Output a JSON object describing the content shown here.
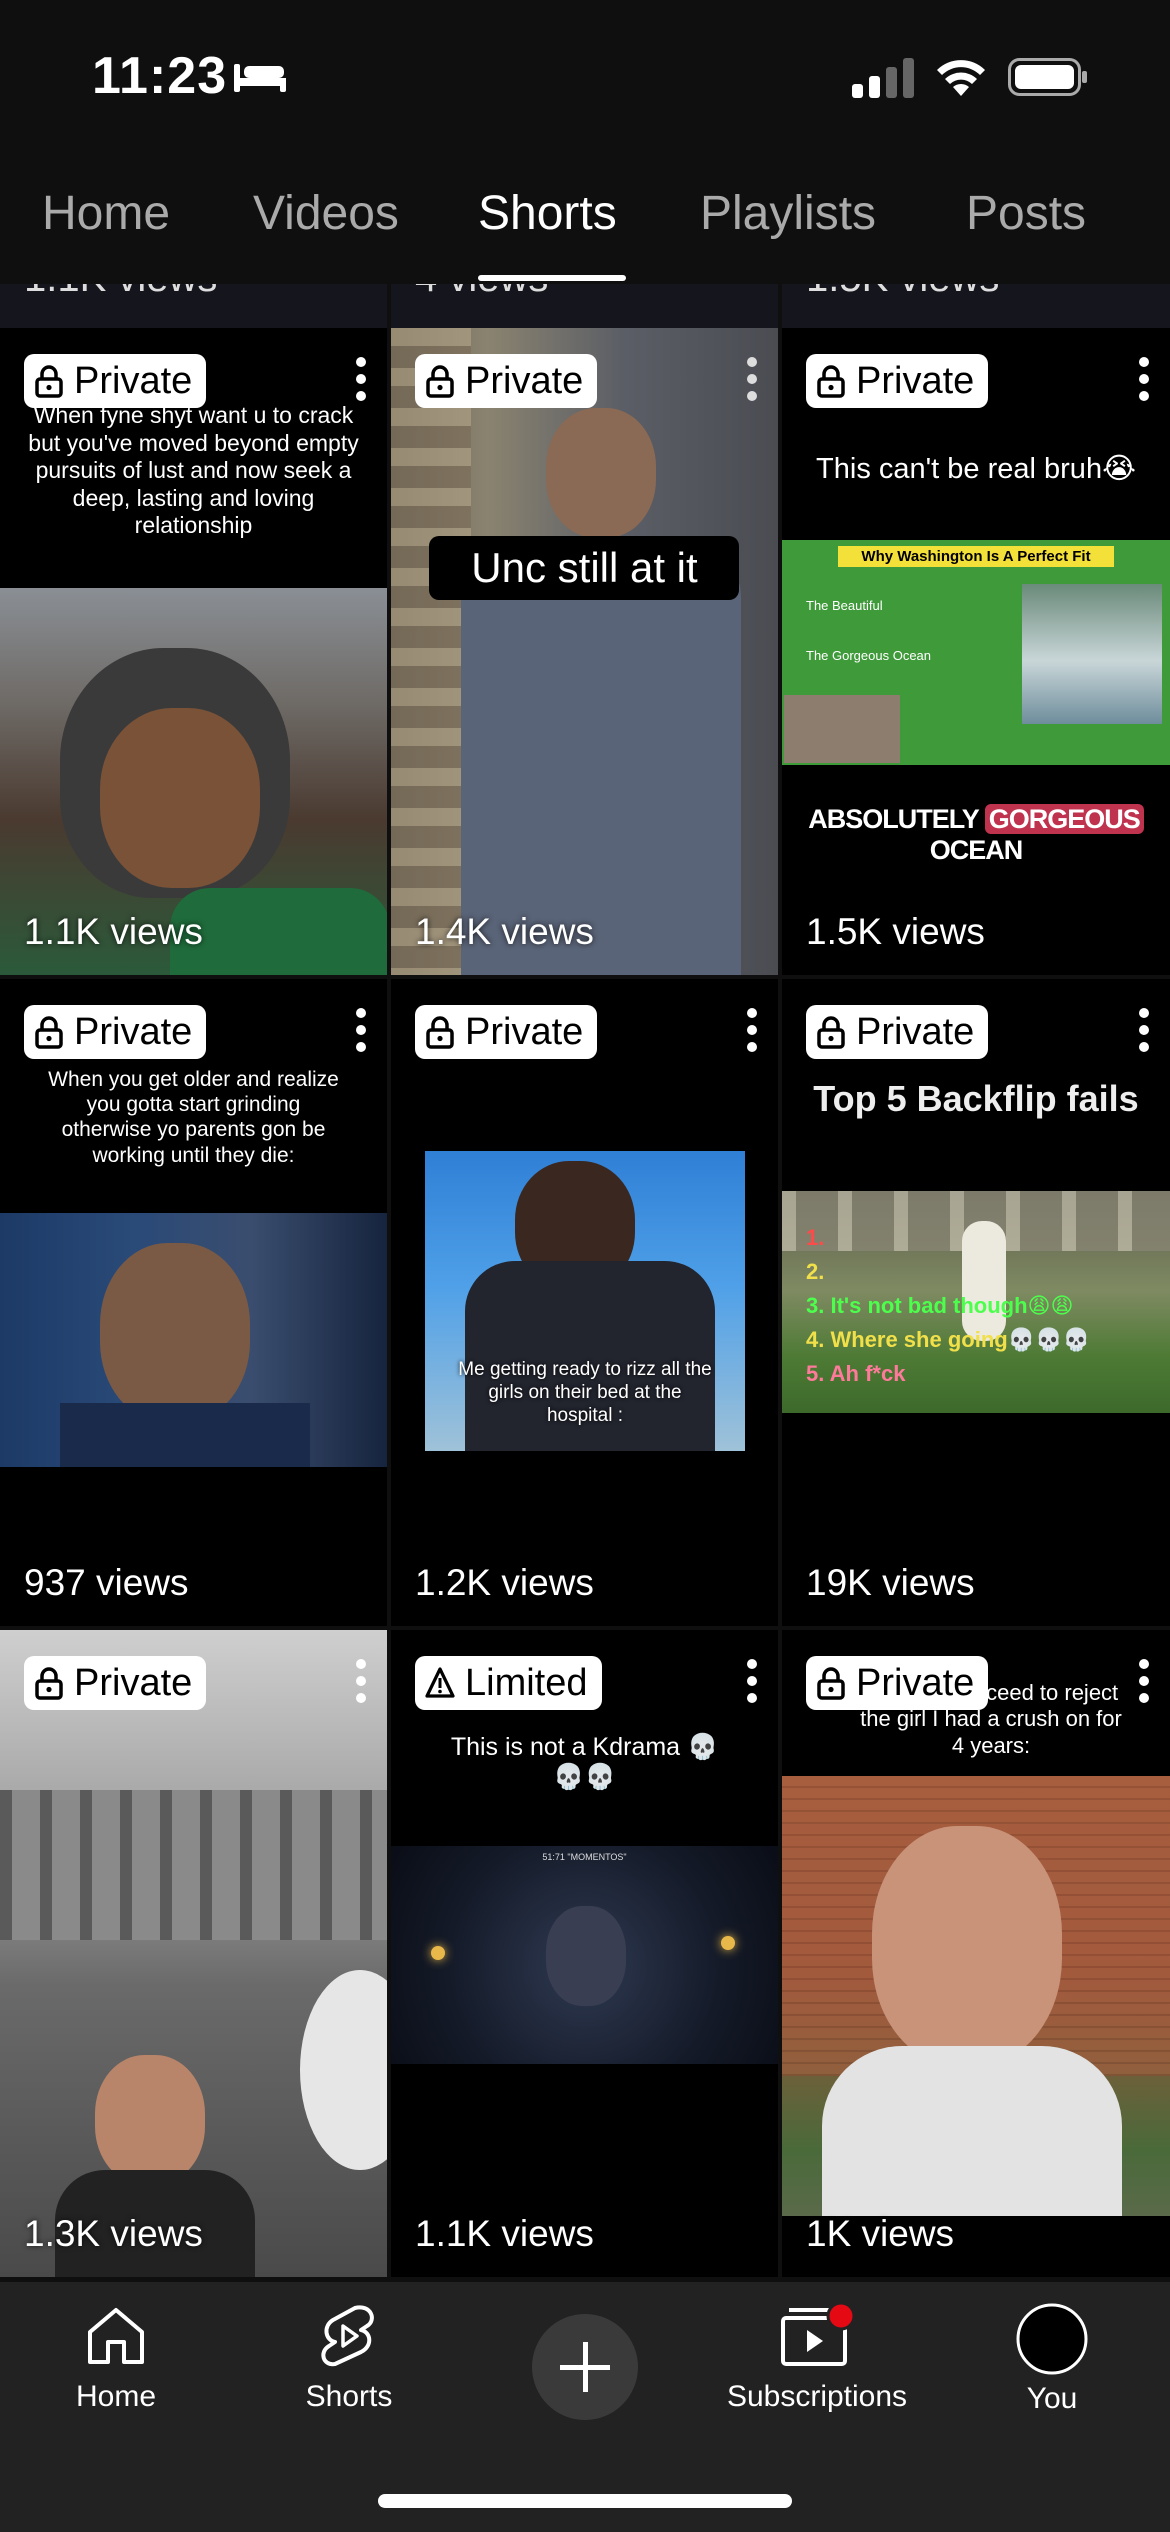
{
  "status_bar": {
    "time": "11:23"
  },
  "tabs": [
    {
      "label": "Home"
    },
    {
      "label": "Videos"
    },
    {
      "label": "Shorts"
    },
    {
      "label": "Playlists"
    },
    {
      "label": "Posts"
    }
  ],
  "active_tab": "Shorts",
  "partial_row": [
    {
      "views": "1.1K views"
    },
    {
      "views": "4 views"
    },
    {
      "views": "1.5K views"
    }
  ],
  "shorts": [
    {
      "badge": "Private",
      "badge_icon": "lock-icon",
      "caption": "When fyne shyt want u to crack but you've moved beyond empty pursuits of lust and now seek a deep, lasting and loving relationship",
      "views": "1.1K views"
    },
    {
      "badge": "Private",
      "badge_icon": "lock-icon",
      "caption": "Unc still at it",
      "views": "1.4K views"
    },
    {
      "badge": "Private",
      "badge_icon": "lock-icon",
      "caption": "This can't be real bruh😭",
      "inner_title": "Why Washington Is A Perfect Fit",
      "inner_bullets": [
        "The Beautiful",
        "The Gorgeous Ocean"
      ],
      "bottom_caption_a": "ABSOLUTELY",
      "bottom_caption_b": "GORGEOUS",
      "bottom_caption_c": "OCEAN",
      "views": "1.5K views"
    },
    {
      "badge": "Private",
      "badge_icon": "lock-icon",
      "caption": "When you get older and realize you gotta start grinding otherwise yo parents gon be working until they die:",
      "views": "937 views"
    },
    {
      "badge": "Private",
      "badge_icon": "lock-icon",
      "caption": "Me getting ready to rizz all the girls on their bed at the hospital :",
      "views": "1.2K views"
    },
    {
      "badge": "Private",
      "badge_icon": "lock-icon",
      "caption": "Top 5 Backflip fails",
      "list": [
        "1.",
        "2.",
        "3. It's not bad though😩😩",
        "4. Where she going💀💀💀",
        "5. Ah f*ck"
      ],
      "views": "19K views"
    },
    {
      "badge": "Private",
      "badge_icon": "lock-icon",
      "caption": "",
      "views": "1.3K views"
    },
    {
      "badge": "Limited",
      "badge_icon": "warning-icon",
      "caption": "This is not a Kdrama 💀💀💀",
      "inner_title": "51:71 \"MOMENTOS\"",
      "views": "1.1K views"
    },
    {
      "badge": "Private",
      "badge_icon": "lock-icon",
      "caption": "t me as I proceed to reject the girl I had a crush on for 4 years:",
      "views": "1K views"
    }
  ],
  "bottom_nav": {
    "home": "Home",
    "shorts": "Shorts",
    "create": "",
    "subscriptions": "Subscriptions",
    "you": "You"
  },
  "colors": {
    "background": "#0f0f0f",
    "nav_background": "#222222",
    "notification_dot": "#e50914"
  }
}
